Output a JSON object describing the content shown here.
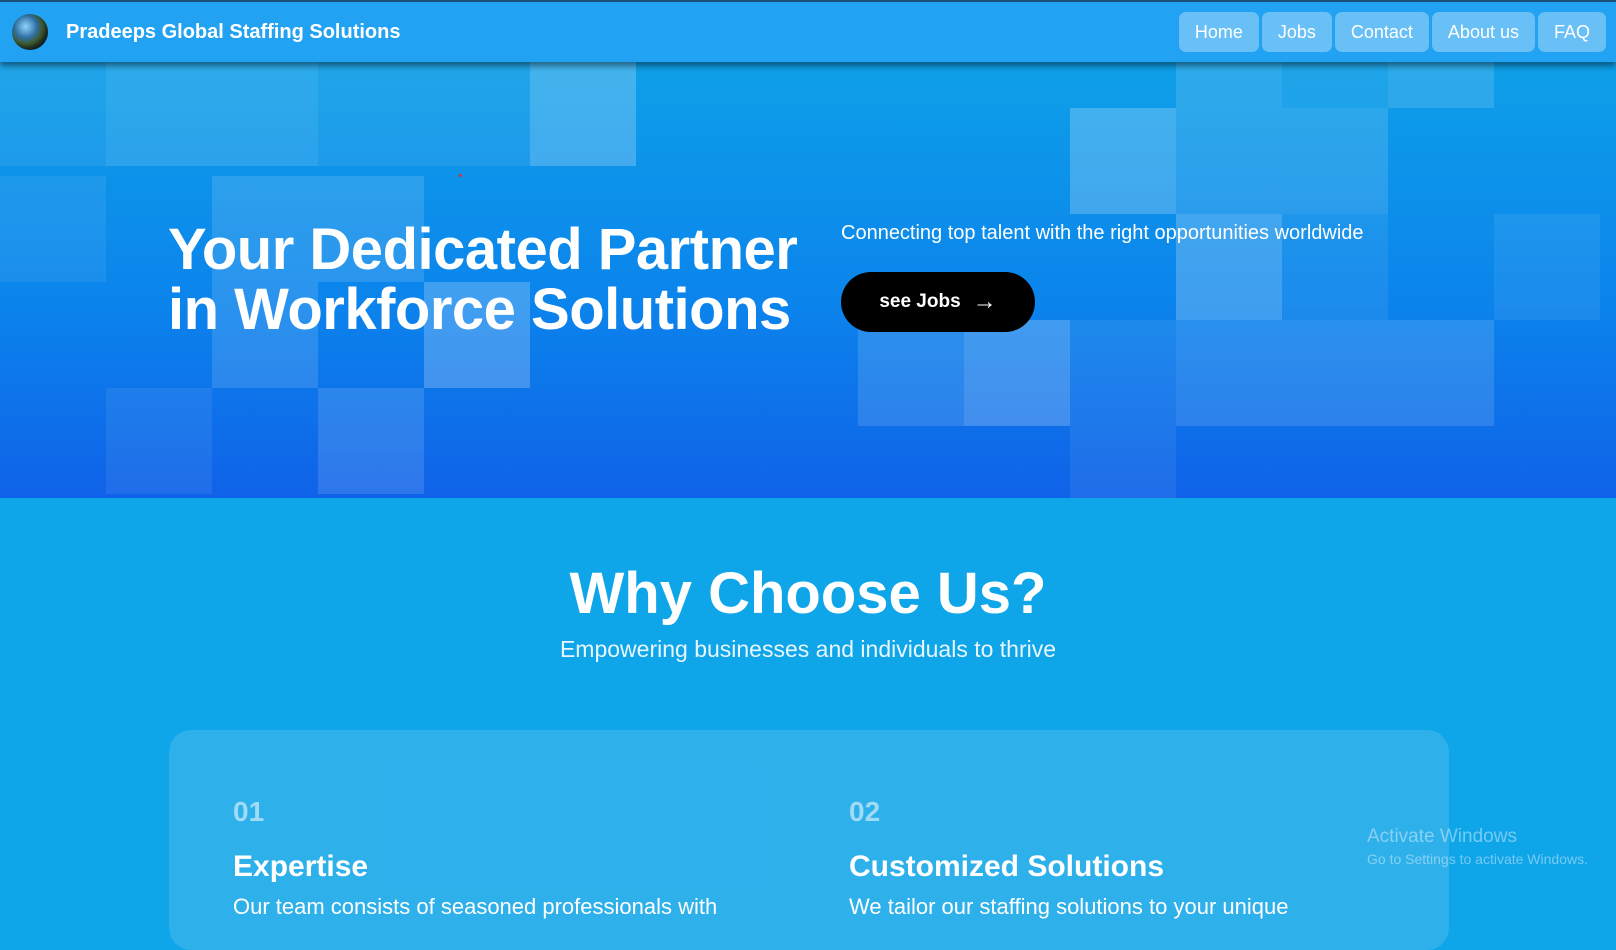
{
  "header": {
    "brand": "Pradeeps Global Staffing Solutions",
    "nav": [
      "Home",
      "Jobs",
      "Contact",
      "About us",
      "FAQ"
    ]
  },
  "hero": {
    "title_line1": "Your Dedicated Partner",
    "title_line2": "in Workforce Solutions",
    "subtitle": "Connecting top talent with the right opportunities worldwide",
    "cta_label": "see Jobs"
  },
  "why": {
    "title": "Why Choose Us?",
    "subtitle": "Empowering businesses and individuals to thrive",
    "features": [
      {
        "number": "01",
        "title": "Expertise",
        "desc": "Our team consists of seasoned professionals with"
      },
      {
        "number": "02",
        "title": "Customized Solutions",
        "desc": "We tailor our staffing solutions to your unique"
      }
    ]
  },
  "watermark": {
    "title": "Activate Windows",
    "subtitle": "Go to Settings to activate Windows."
  },
  "colors": {
    "topbar": "#22a2f2",
    "hero_top": "#0ea0e8",
    "hero_bottom": "#1062e8",
    "section_bg": "#0fa5e9",
    "cta_bg": "#000000"
  },
  "icons": {
    "logo": "globe-logo",
    "cta": "arrow-right-icon"
  }
}
